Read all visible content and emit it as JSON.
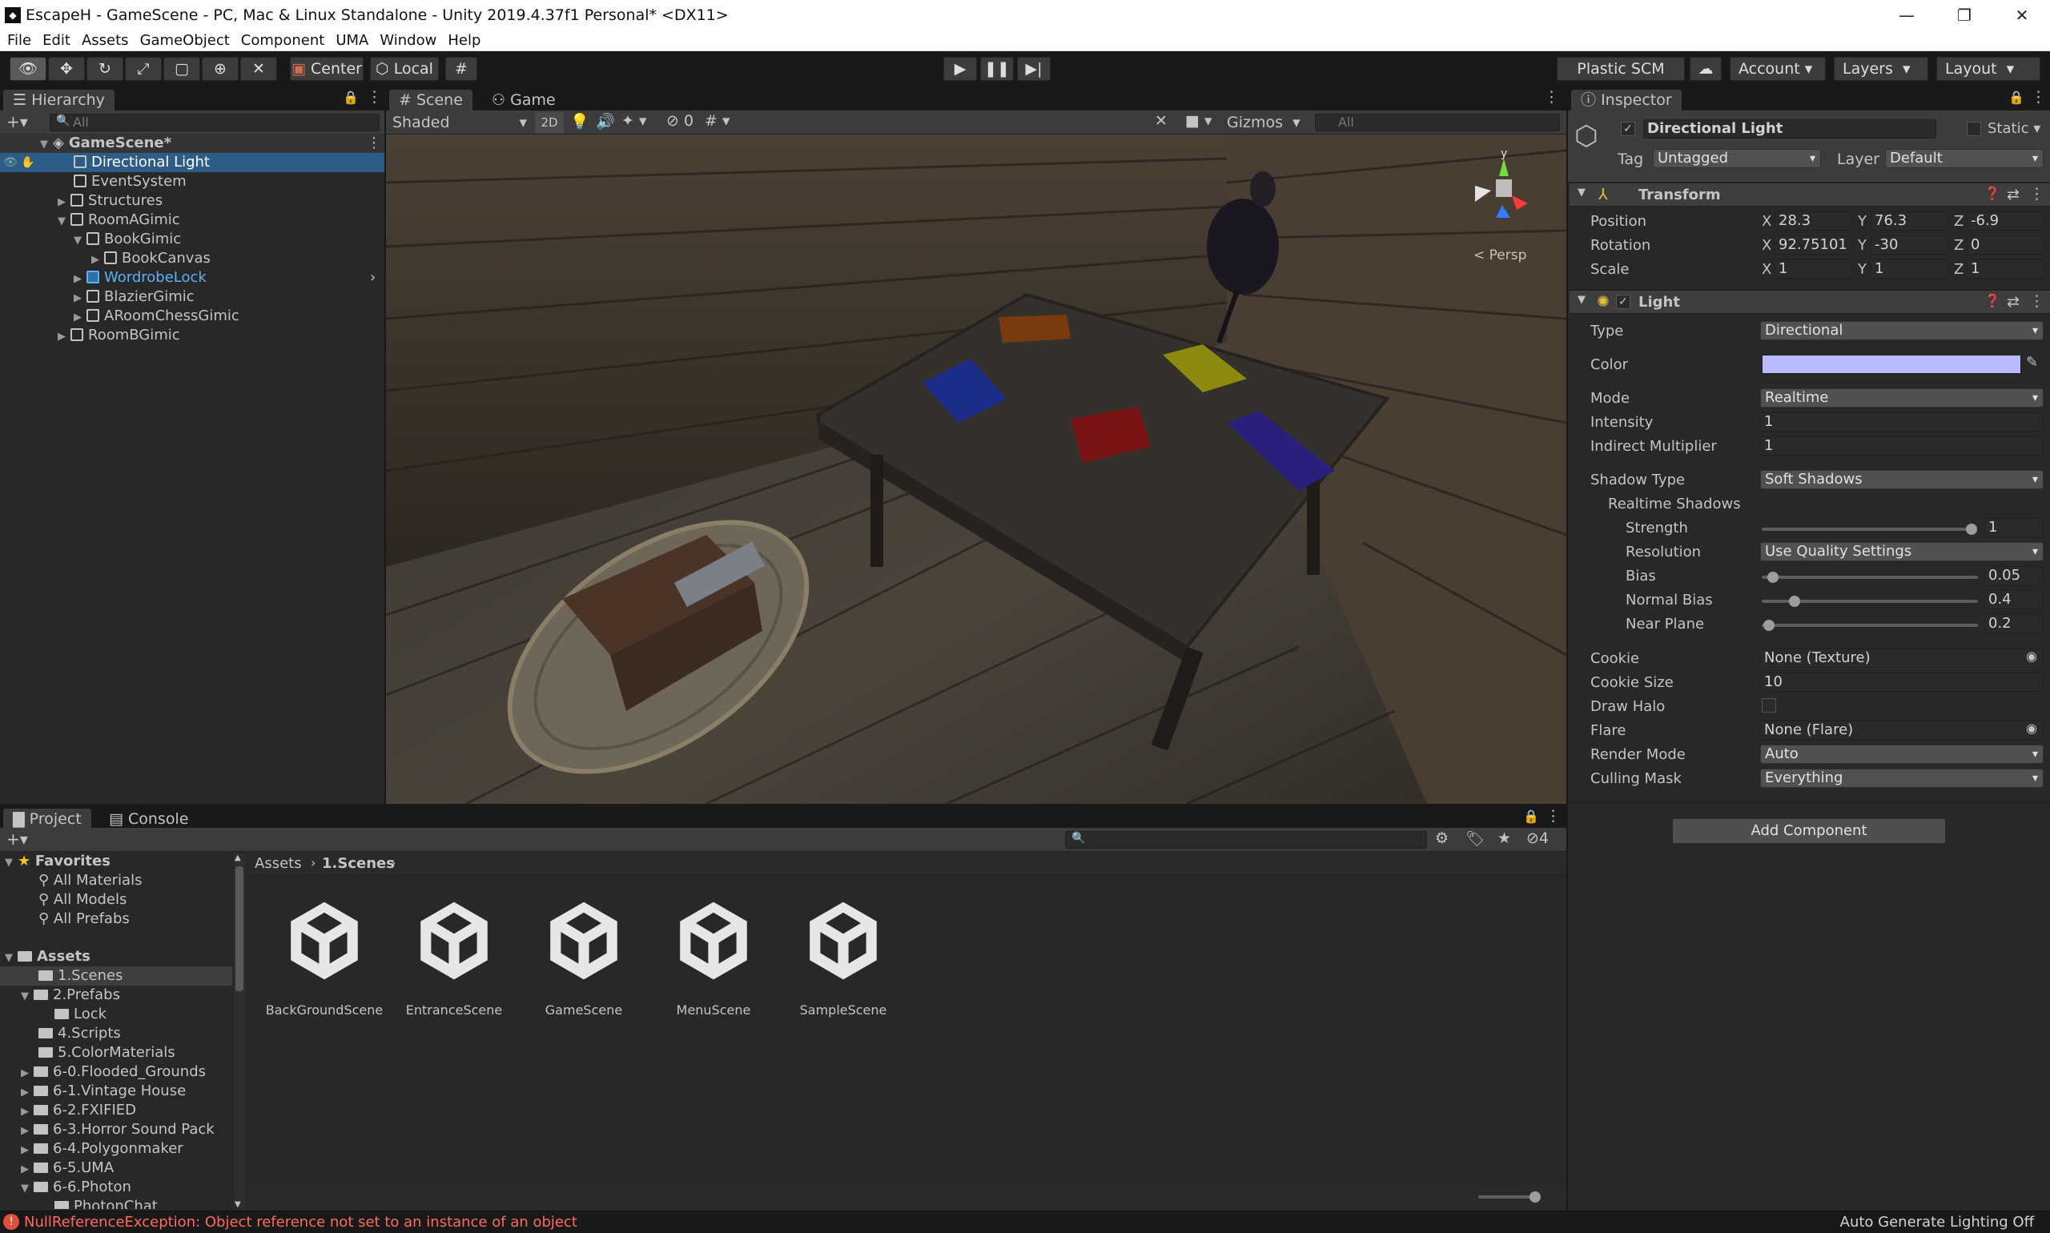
{
  "window": {
    "title": "EscapeH - GameScene - PC, Mac & Linux Standalone - Unity 2019.4.37f1 Personal* <DX11>",
    "min": "—",
    "max": "❐",
    "close": "✕"
  },
  "menu": [
    "File",
    "Edit",
    "Assets",
    "GameObject",
    "Component",
    "UMA",
    "Window",
    "Help"
  ],
  "toolbar": {
    "center": "Center",
    "local": "Local",
    "plastic": "Plastic SCM",
    "account": "Account",
    "layers": "Layers",
    "layout": "Layout"
  },
  "hierarchy": {
    "tab": "Hierarchy",
    "search_placeholder": "All",
    "scene": "GameScene*",
    "items": [
      {
        "label": "Directional Light"
      },
      {
        "label": "EventSystem"
      },
      {
        "label": "Structures"
      },
      {
        "label": "RoomAGimic"
      },
      {
        "label": "BookGimic"
      },
      {
        "label": "BookCanvas"
      },
      {
        "label": "WordrobeLock"
      },
      {
        "label": "BlazierGimic"
      },
      {
        "label": "ARoomChessGimic"
      },
      {
        "label": "RoomBGimic"
      }
    ]
  },
  "scene_view": {
    "tab_scene": "Scene",
    "tab_game": "Game",
    "shading": "Shaded",
    "mode_2d": "2D",
    "hidden_count": "0",
    "gizmos": "Gizmos",
    "search_placeholder": "All",
    "persp": "< Persp",
    "gizmo_y": "y"
  },
  "inspector": {
    "tab": "Inspector",
    "object_name": "Directional Light",
    "static_label": "Static",
    "tag_label": "Tag",
    "tag_value": "Untagged",
    "layer_label": "Layer",
    "layer_value": "Default",
    "transform": {
      "title": "Transform",
      "position": {
        "label": "Position",
        "x": "28.3",
        "y": "76.3",
        "z": "-6.9"
      },
      "rotation": {
        "label": "Rotation",
        "x": "92.75101",
        "y": "-30",
        "z": "0"
      },
      "scale": {
        "label": "Scale",
        "x": "1",
        "y": "1",
        "z": "1"
      }
    },
    "light": {
      "title": "Light",
      "type_label": "Type",
      "type": "Directional",
      "color_label": "Color",
      "color": "#b8bcff",
      "mode_label": "Mode",
      "mode": "Realtime",
      "intensity_label": "Intensity",
      "intensity": "1",
      "indirect_label": "Indirect Multiplier",
      "indirect": "1",
      "shadow_type_label": "Shadow Type",
      "shadow_type": "Soft Shadows",
      "realtime_shadows": "Realtime Shadows",
      "strength_label": "Strength",
      "strength": "1",
      "resolution_label": "Resolution",
      "resolution": "Use Quality Settings",
      "bias_label": "Bias",
      "bias": "0.05",
      "normal_bias_label": "Normal Bias",
      "normal_bias": "0.4",
      "near_plane_label": "Near Plane",
      "near_plane": "0.2",
      "cookie_label": "Cookie",
      "cookie": "None (Texture)",
      "cookie_size_label": "Cookie Size",
      "cookie_size": "10",
      "draw_halo_label": "Draw Halo",
      "flare_label": "Flare",
      "flare": "None (Flare)",
      "render_mode_label": "Render Mode",
      "render_mode": "Auto",
      "culling_mask_label": "Culling Mask",
      "culling_mask": "Everything"
    },
    "add_component": "Add Component"
  },
  "project": {
    "tab_project": "Project",
    "tab_console": "Console",
    "hidden_count": "4",
    "favorites": "Favorites",
    "fav_items": [
      "All Materials",
      "All Models",
      "All Prefabs"
    ],
    "assets": "Assets",
    "folders": [
      "1.Scenes",
      "2.Prefabs",
      "Lock",
      "4.Scripts",
      "5.ColorMaterials",
      "6-0.Flooded_Grounds",
      "6-1.Vintage House",
      "6-2.FXIFIED",
      "6-3.Horror Sound Pack",
      "6-4.Polygonmaker",
      "6-5.UMA",
      "6-6.Photon",
      "PhotonChat"
    ],
    "breadcrumb": [
      "Assets",
      "1.Scenes"
    ],
    "scenes": [
      "BackGroundScene",
      "EntranceScene",
      "GameScene",
      "MenuScene",
      "SampleScene"
    ]
  },
  "status": {
    "error": "NullReferenceException: Object reference not set to an instance of an object",
    "lighting": "Auto Generate Lighting Off"
  },
  "colors": {
    "selection": "#2c5d87",
    "error": "#ff6b5b",
    "prefab": "#5cb0f6"
  }
}
